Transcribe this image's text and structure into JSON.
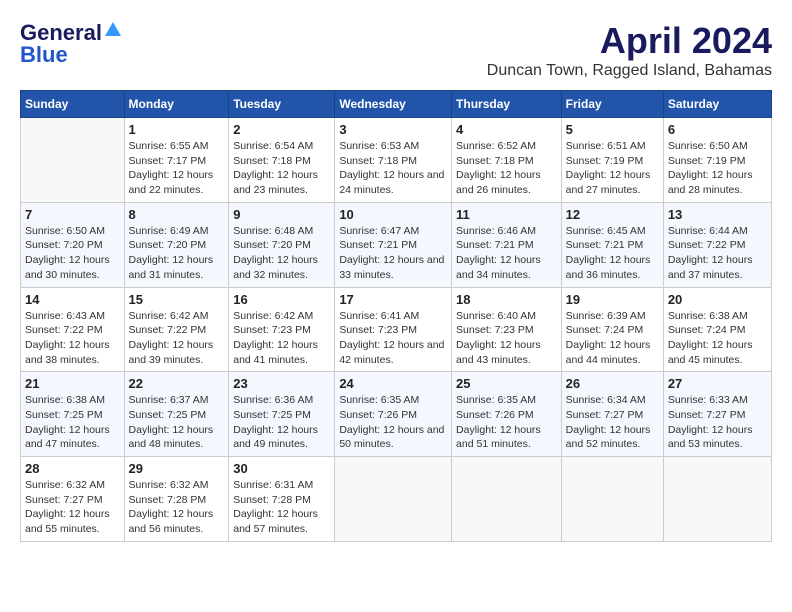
{
  "header": {
    "logo_general": "General",
    "logo_blue": "Blue",
    "month_title": "April 2024",
    "location": "Duncan Town, Ragged Island, Bahamas"
  },
  "columns": [
    "Sunday",
    "Monday",
    "Tuesday",
    "Wednesday",
    "Thursday",
    "Friday",
    "Saturday"
  ],
  "weeks": [
    [
      {
        "day": "",
        "empty": true
      },
      {
        "day": "1",
        "sunrise": "Sunrise: 6:55 AM",
        "sunset": "Sunset: 7:17 PM",
        "daylight": "Daylight: 12 hours and 22 minutes."
      },
      {
        "day": "2",
        "sunrise": "Sunrise: 6:54 AM",
        "sunset": "Sunset: 7:18 PM",
        "daylight": "Daylight: 12 hours and 23 minutes."
      },
      {
        "day": "3",
        "sunrise": "Sunrise: 6:53 AM",
        "sunset": "Sunset: 7:18 PM",
        "daylight": "Daylight: 12 hours and 24 minutes."
      },
      {
        "day": "4",
        "sunrise": "Sunrise: 6:52 AM",
        "sunset": "Sunset: 7:18 PM",
        "daylight": "Daylight: 12 hours and 26 minutes."
      },
      {
        "day": "5",
        "sunrise": "Sunrise: 6:51 AM",
        "sunset": "Sunset: 7:19 PM",
        "daylight": "Daylight: 12 hours and 27 minutes."
      },
      {
        "day": "6",
        "sunrise": "Sunrise: 6:50 AM",
        "sunset": "Sunset: 7:19 PM",
        "daylight": "Daylight: 12 hours and 28 minutes."
      }
    ],
    [
      {
        "day": "7",
        "sunrise": "Sunrise: 6:50 AM",
        "sunset": "Sunset: 7:20 PM",
        "daylight": "Daylight: 12 hours and 30 minutes."
      },
      {
        "day": "8",
        "sunrise": "Sunrise: 6:49 AM",
        "sunset": "Sunset: 7:20 PM",
        "daylight": "Daylight: 12 hours and 31 minutes."
      },
      {
        "day": "9",
        "sunrise": "Sunrise: 6:48 AM",
        "sunset": "Sunset: 7:20 PM",
        "daylight": "Daylight: 12 hours and 32 minutes."
      },
      {
        "day": "10",
        "sunrise": "Sunrise: 6:47 AM",
        "sunset": "Sunset: 7:21 PM",
        "daylight": "Daylight: 12 hours and 33 minutes."
      },
      {
        "day": "11",
        "sunrise": "Sunrise: 6:46 AM",
        "sunset": "Sunset: 7:21 PM",
        "daylight": "Daylight: 12 hours and 34 minutes."
      },
      {
        "day": "12",
        "sunrise": "Sunrise: 6:45 AM",
        "sunset": "Sunset: 7:21 PM",
        "daylight": "Daylight: 12 hours and 36 minutes."
      },
      {
        "day": "13",
        "sunrise": "Sunrise: 6:44 AM",
        "sunset": "Sunset: 7:22 PM",
        "daylight": "Daylight: 12 hours and 37 minutes."
      }
    ],
    [
      {
        "day": "14",
        "sunrise": "Sunrise: 6:43 AM",
        "sunset": "Sunset: 7:22 PM",
        "daylight": "Daylight: 12 hours and 38 minutes."
      },
      {
        "day": "15",
        "sunrise": "Sunrise: 6:42 AM",
        "sunset": "Sunset: 7:22 PM",
        "daylight": "Daylight: 12 hours and 39 minutes."
      },
      {
        "day": "16",
        "sunrise": "Sunrise: 6:42 AM",
        "sunset": "Sunset: 7:23 PM",
        "daylight": "Daylight: 12 hours and 41 minutes."
      },
      {
        "day": "17",
        "sunrise": "Sunrise: 6:41 AM",
        "sunset": "Sunset: 7:23 PM",
        "daylight": "Daylight: 12 hours and 42 minutes."
      },
      {
        "day": "18",
        "sunrise": "Sunrise: 6:40 AM",
        "sunset": "Sunset: 7:23 PM",
        "daylight": "Daylight: 12 hours and 43 minutes."
      },
      {
        "day": "19",
        "sunrise": "Sunrise: 6:39 AM",
        "sunset": "Sunset: 7:24 PM",
        "daylight": "Daylight: 12 hours and 44 minutes."
      },
      {
        "day": "20",
        "sunrise": "Sunrise: 6:38 AM",
        "sunset": "Sunset: 7:24 PM",
        "daylight": "Daylight: 12 hours and 45 minutes."
      }
    ],
    [
      {
        "day": "21",
        "sunrise": "Sunrise: 6:38 AM",
        "sunset": "Sunset: 7:25 PM",
        "daylight": "Daylight: 12 hours and 47 minutes."
      },
      {
        "day": "22",
        "sunrise": "Sunrise: 6:37 AM",
        "sunset": "Sunset: 7:25 PM",
        "daylight": "Daylight: 12 hours and 48 minutes."
      },
      {
        "day": "23",
        "sunrise": "Sunrise: 6:36 AM",
        "sunset": "Sunset: 7:25 PM",
        "daylight": "Daylight: 12 hours and 49 minutes."
      },
      {
        "day": "24",
        "sunrise": "Sunrise: 6:35 AM",
        "sunset": "Sunset: 7:26 PM",
        "daylight": "Daylight: 12 hours and 50 minutes."
      },
      {
        "day": "25",
        "sunrise": "Sunrise: 6:35 AM",
        "sunset": "Sunset: 7:26 PM",
        "daylight": "Daylight: 12 hours and 51 minutes."
      },
      {
        "day": "26",
        "sunrise": "Sunrise: 6:34 AM",
        "sunset": "Sunset: 7:27 PM",
        "daylight": "Daylight: 12 hours and 52 minutes."
      },
      {
        "day": "27",
        "sunrise": "Sunrise: 6:33 AM",
        "sunset": "Sunset: 7:27 PM",
        "daylight": "Daylight: 12 hours and 53 minutes."
      }
    ],
    [
      {
        "day": "28",
        "sunrise": "Sunrise: 6:32 AM",
        "sunset": "Sunset: 7:27 PM",
        "daylight": "Daylight: 12 hours and 55 minutes."
      },
      {
        "day": "29",
        "sunrise": "Sunrise: 6:32 AM",
        "sunset": "Sunset: 7:28 PM",
        "daylight": "Daylight: 12 hours and 56 minutes."
      },
      {
        "day": "30",
        "sunrise": "Sunrise: 6:31 AM",
        "sunset": "Sunset: 7:28 PM",
        "daylight": "Daylight: 12 hours and 57 minutes."
      },
      {
        "day": "",
        "empty": true
      },
      {
        "day": "",
        "empty": true
      },
      {
        "day": "",
        "empty": true
      },
      {
        "day": "",
        "empty": true
      }
    ]
  ]
}
